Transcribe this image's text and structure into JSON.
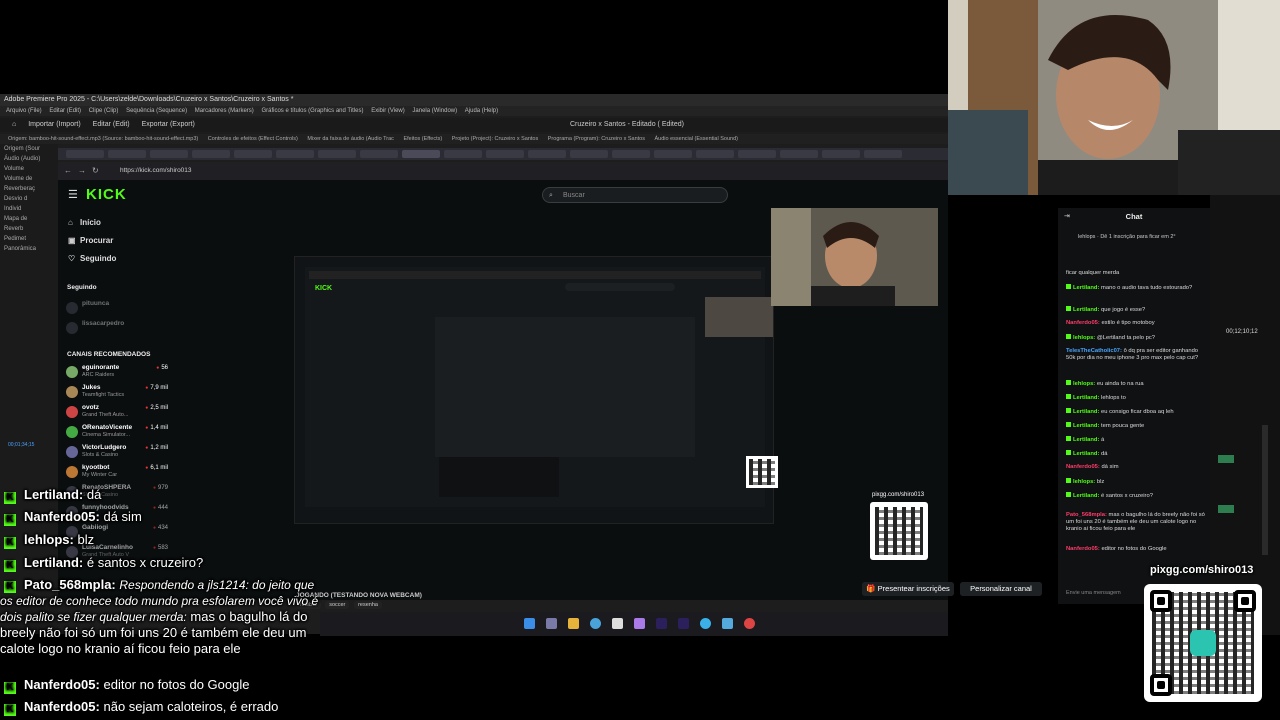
{
  "premiere": {
    "title": "Adobe Premiere Pro 2025 - C:\\Users\\zelde\\Downloads\\Cruzeiro x Santos\\Cruzeiro x Santos *",
    "menu": [
      "Arquivo (File)",
      "Editar (Edit)",
      "Clipe (Clip)",
      "Sequência (Sequence)",
      "Marcadores (Markers)",
      "Gráficos e títulos (Graphics and Titles)",
      "Exibir (View)",
      "Janela (Window)",
      "Ajuda (Help)"
    ],
    "workspace_tabs": [
      "Importar (Import)",
      "Editar (Edit)",
      "Exportar (Export)"
    ],
    "doc_title": "Cruzeiro x Santos - Editado ( Edited)",
    "panel_tabs": [
      "Origem: bamboo-hit-sound-effect.mp3 (Source: bamboo-hit-sound-effect.mp3)",
      "Controles de efeitos (Effect Controls)",
      "Mixer da faixa de áudio (Audio Trac",
      "Efeitos (Effects)",
      "Projeto (Project): Cruzeiro x Santos",
      "Programa (Program): Cruzeiro x Santos",
      "Áudio essencial (Essential Sound)"
    ],
    "left_panel": [
      "Origem (Sour",
      "Áudio (Audio)",
      "Volume",
      "Volume de",
      "Reverberaç",
      "Desvio d",
      "Individ",
      "Mapa de",
      "Reverb",
      "Pedimet",
      "Panorâmica"
    ],
    "timecode": "00;12;10;12",
    "timecode_left": "00;01;34;15"
  },
  "browser": {
    "url": "https://kick.com/shiro013"
  },
  "kick": {
    "logo": "KICK",
    "search_placeholder": "Buscar",
    "nav": [
      {
        "label": "Início",
        "icon": "home-icon"
      },
      {
        "label": "Procurar",
        "icon": "browse-icon"
      },
      {
        "label": "Seguindo",
        "icon": "heart-icon"
      }
    ],
    "following_heading": "Seguindo",
    "following": [
      "pituunca",
      "lissacarpedro"
    ],
    "recommended_heading": "CANAIS RECOMENDADOS",
    "recommended": [
      {
        "name": "eguinorante",
        "game": "ARC Raiders",
        "viewers": "56"
      },
      {
        "name": "Jukes",
        "game": "Teamfight Tactics",
        "viewers": "7,9 mil"
      },
      {
        "name": "ovotz",
        "game": "Grand Theft Auto...",
        "viewers": "2,5 mil"
      },
      {
        "name": "ORenatoVicente",
        "game": "Cinema Simulator...",
        "viewers": "1,4 mil"
      },
      {
        "name": "VictorLudgero",
        "game": "Slots & Casino",
        "viewers": "1,2 mil"
      },
      {
        "name": "kyootbot",
        "game": "My Winter Car",
        "viewers": "6,1 mil"
      },
      {
        "name": "RenatoSHPERA",
        "game": "Slots & Casino",
        "viewers": "979"
      },
      {
        "name": "funnyhoodvids",
        "game": "",
        "viewers": "444"
      },
      {
        "name": "Gabiiogi",
        "game": "",
        "viewers": "434"
      },
      {
        "name": "LuisaCarnelinho",
        "game": "Grand Theft Auto V",
        "viewers": "583"
      }
    ],
    "present_button": "Presentear inscrições",
    "customize_button": "Personalizar canal",
    "stream_title": "JOGANDO (TESTANDO NOVA WEBCAM)",
    "stream_tags": [
      "futebol",
      "soccer",
      "resenha"
    ],
    "chat": {
      "title": "Chat",
      "pinned": "lehlops · Dê 1 inscrição para ficar em 2°",
      "input_placeholder": "Envie uma mensagem",
      "messages": [
        {
          "user": "",
          "text": "ficar qualquer merda",
          "color": "g"
        },
        {
          "user": "Lertiland:",
          "text": "mano o audio tava tudo estourado?",
          "color": "g"
        },
        {
          "user": "Lertiland:",
          "text": "que jogo é esse?",
          "color": "g"
        },
        {
          "user": "Nanferdo05:",
          "text": "estilo é tipo motoboy",
          "color": "r"
        },
        {
          "user": "lehlops:",
          "text": "@Lertiland ta pelo pc?",
          "color": "g"
        },
        {
          "user": "TelesTheCatholic07:",
          "text": "ô dq pra ser editor ganhando 50k por dia no meu iphone 3 pro max pelo cap cut?",
          "color": "b"
        },
        {
          "user": "lehlops:",
          "text": "eu ainda to na rua",
          "color": "g"
        },
        {
          "user": "Lertiland:",
          "text": "lehlops to",
          "color": "g"
        },
        {
          "user": "Lertiland:",
          "text": "eu consigo ficar dboa aq leh",
          "color": "g"
        },
        {
          "user": "Lertiland:",
          "text": "tem pouca gente",
          "color": "g"
        },
        {
          "user": "Lertiland:",
          "text": "á",
          "color": "g"
        },
        {
          "user": "Lertiland:",
          "text": "dá",
          "color": "g"
        },
        {
          "user": "Nanferdo05:",
          "text": "dá sim",
          "color": "r"
        },
        {
          "user": "lehlops:",
          "text": "blz",
          "color": "g"
        },
        {
          "user": "Lertiland:",
          "text": "é santos x cruzeiro?",
          "color": "g"
        },
        {
          "user": "Pato_568mpla:",
          "text": "mas o bagulho lá do breely não foi só um foi uns 20 é também ele deu um calote logo no kranio ai ficou feio para ele",
          "color": "r"
        },
        {
          "user": "Nanferdo05:",
          "text": "editor no fotos do Google",
          "color": "r"
        }
      ]
    }
  },
  "overlay_chat": {
    "lines": [
      {
        "user": "Lertiland:",
        "text": "dá"
      },
      {
        "user": "Nanferdo05:",
        "text": "dá sim"
      },
      {
        "user": "lehlops:",
        "text": "blz"
      },
      {
        "user": "Lertiland:",
        "text": "é santos x cruzeiro?"
      }
    ],
    "reply_user": "Pato_568mpla:",
    "reply_quote": "Respondendo a jls1214: do jeito que os editor de conhece todo mundo pra esfolarem você vivo é dois palito se fizer qualquer merda:",
    "reply_text": "mas o bagulho lá do breely não foi só um foi uns 20 é também ele deu um calote logo no kranio aí ficou feio para ele",
    "lines_after": [
      {
        "user": "Nanferdo05:",
        "text": "editor no fotos do Google"
      },
      {
        "user": "Nanferdo05:",
        "text": "não sejam caloteiros, é errado"
      }
    ]
  },
  "qr": {
    "label": "pixgg.com/shiro013",
    "small_label": "pixgg.com/shiro013"
  },
  "colors": {
    "kick_green": "#53fc18",
    "premiere_bg": "#1d1d1d",
    "chat_red": "#ff3d6a"
  }
}
